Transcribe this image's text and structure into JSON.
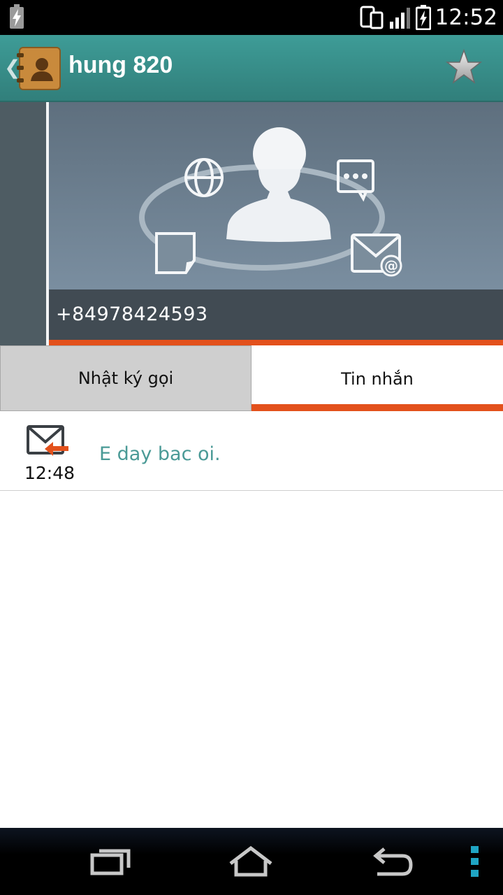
{
  "status_bar": {
    "time": "12:52",
    "icons": [
      "charging-icon",
      "phone-tablet-icon",
      "signal-icon",
      "battery-icon"
    ]
  },
  "action_bar": {
    "title": "hung 820",
    "icons": [
      "back-chevron-icon",
      "contacts-app-icon",
      "favorite-star-icon"
    ]
  },
  "contact": {
    "phone_number": "+84978424593",
    "graphic_icons": [
      "person-silhouette-icon",
      "globe-icon",
      "chat-bubble-icon",
      "note-icon",
      "email-at-icon"
    ]
  },
  "tabs": [
    {
      "label": "Nhật ký gọi",
      "selected": false
    },
    {
      "label": "Tin nhắn",
      "selected": true
    }
  ],
  "messages": [
    {
      "time": "12:48",
      "text": "E day bac oi.",
      "direction": "incoming",
      "icon": "incoming-mail-icon"
    }
  ],
  "nav_bar": {
    "icons": [
      "recent-apps-icon",
      "home-icon",
      "back-icon",
      "menu-dots-icon"
    ]
  },
  "colors": {
    "action_bar": "#3e9c97",
    "accent": "#e3511c",
    "message_text": "#4a9a96",
    "header_bg": "#5f7180",
    "phone_bar": "#414b53"
  }
}
